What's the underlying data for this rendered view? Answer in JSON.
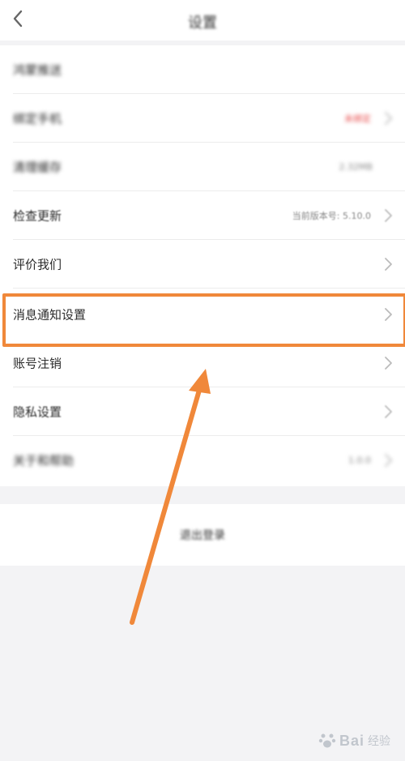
{
  "header": {
    "title": "设置"
  },
  "settings": [
    {
      "label": "鸿蒙推送",
      "value": ""
    },
    {
      "label": "绑定手机",
      "value": "未绑定"
    },
    {
      "label": "清理缓存",
      "value": "2.32MB"
    },
    {
      "label": "检查更新",
      "value": "当前版本号: 5.10.0"
    },
    {
      "label": "评价我们",
      "value": ""
    },
    {
      "label": "消息通知设置",
      "value": ""
    },
    {
      "label": "账号注销",
      "value": ""
    },
    {
      "label": "隐私设置",
      "value": ""
    },
    {
      "label": "关于和帮助",
      "value": "1.0.0"
    }
  ],
  "logout": {
    "label": "退出登录"
  },
  "highlight_color": "#f0883a",
  "watermark": {
    "brand": "Bai",
    "suffix": "经验"
  }
}
